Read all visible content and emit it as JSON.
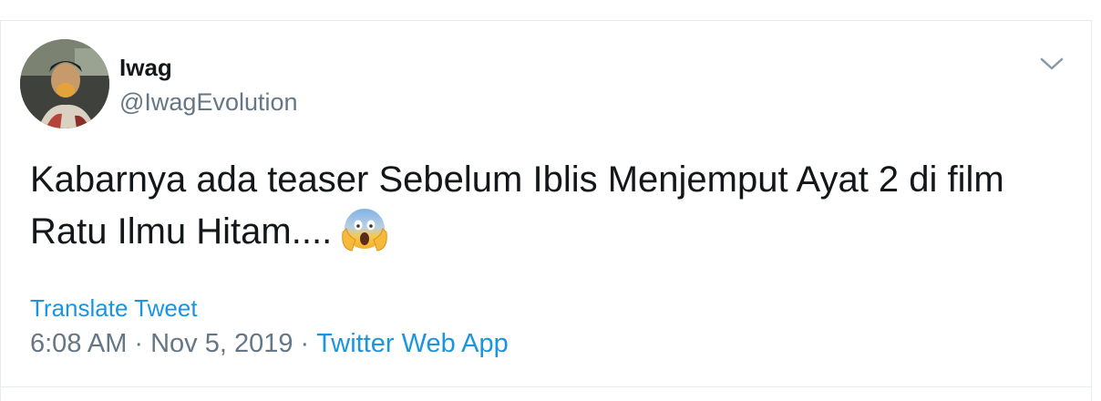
{
  "tweet": {
    "author_name": "Iwag",
    "author_handle": "@IwagEvolution",
    "text": "Kabarnya ada teaser Sebelum Iblis Menjemput Ayat 2 di film Ratu Ilmu Hitam....",
    "emoji": "face-screaming-in-fear",
    "translate_label": "Translate Tweet",
    "time": "6:08 AM",
    "separator": "·",
    "date": "Nov 5, 2019",
    "source": "Twitter Web App"
  },
  "icons": {
    "more_menu": "chevron-down-icon",
    "avatar": "avatar"
  },
  "colors": {
    "text_primary": "#14171a",
    "text_secondary": "#657786",
    "link": "#1b95e0",
    "border": "#e6ecf0"
  }
}
